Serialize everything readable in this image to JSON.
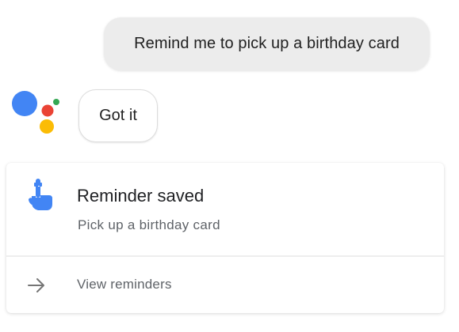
{
  "conversation": {
    "user_query": "Remind me to pick up a birthday card",
    "assistant_reply": "Got it"
  },
  "card": {
    "icon": "reminder-hand-icon",
    "title": "Reminder saved",
    "subtitle": "Pick up a birthday card",
    "action_icon": "arrow-right-icon",
    "action_label": "View reminders"
  },
  "colors": {
    "google_blue": "#4285F4",
    "google_red": "#EA4335",
    "google_yellow": "#FBBC05",
    "google_green": "#34A853",
    "user_bubble": "#ECECEC"
  }
}
